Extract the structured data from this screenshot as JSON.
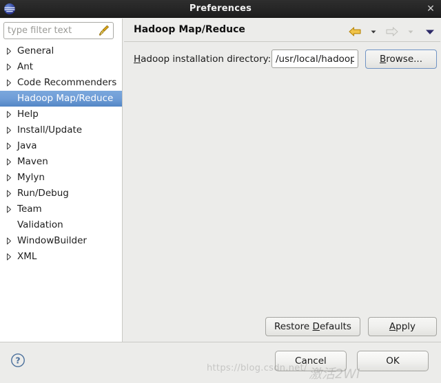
{
  "window": {
    "title": "Preferences",
    "logo_icon": "eclipse-logo",
    "close_icon": "close-icon",
    "close_label": "✕"
  },
  "sidebar": {
    "filter": {
      "placeholder": "type filter text",
      "value": "",
      "clear_icon": "broom-icon"
    },
    "items": [
      {
        "label": "General",
        "expandable": true,
        "selected": false
      },
      {
        "label": "Ant",
        "expandable": true,
        "selected": false
      },
      {
        "label": "Code Recommenders",
        "expandable": true,
        "selected": false
      },
      {
        "label": "Hadoop Map/Reduce",
        "expandable": false,
        "selected": true
      },
      {
        "label": "Help",
        "expandable": true,
        "selected": false
      },
      {
        "label": "Install/Update",
        "expandable": true,
        "selected": false
      },
      {
        "label": "Java",
        "expandable": true,
        "selected": false
      },
      {
        "label": "Maven",
        "expandable": true,
        "selected": false
      },
      {
        "label": "Mylyn",
        "expandable": true,
        "selected": false
      },
      {
        "label": "Run/Debug",
        "expandable": true,
        "selected": false
      },
      {
        "label": "Team",
        "expandable": true,
        "selected": false
      },
      {
        "label": "Validation",
        "expandable": false,
        "selected": false
      },
      {
        "label": "WindowBuilder",
        "expandable": true,
        "selected": false
      },
      {
        "label": "XML",
        "expandable": true,
        "selected": false
      }
    ]
  },
  "page": {
    "title": "Hadoop Map/Reduce",
    "nav": {
      "back_icon": "back-arrow-icon",
      "back_enabled": true,
      "back_menu_icon": "chevron-down-icon",
      "forward_icon": "forward-arrow-icon",
      "forward_enabled": false,
      "forward_menu_icon": "chevron-down-icon",
      "view_menu_icon": "triangle-down-icon"
    },
    "field": {
      "label_prefix": "H",
      "label_rest": "adoop installation directory:",
      "value": "/usr/local/hadoop",
      "browse_prefix": "B",
      "browse_rest": "rowse..."
    },
    "buttons": {
      "restore_prefix": "Restore ",
      "restore_mnemonic": "D",
      "restore_rest": "efaults",
      "apply_mnemonic": "A",
      "apply_rest": "pply"
    }
  },
  "footer": {
    "help_icon": "help-question-icon",
    "cancel_label": "Cancel",
    "ok_label": "OK"
  },
  "watermark": {
    "url": "https://blog.csdn.net/",
    "text": "激活2Wi"
  },
  "colors": {
    "titlebar": "#272727",
    "selection": "#6f9dd7",
    "panel": "#ececea",
    "sidebar": "#ffffff",
    "accent_focus": "#6f93c4",
    "back_arrow": "#e8a317",
    "forward_arrow": "#cfcfc9",
    "help_icon": "#4a6f9b"
  }
}
